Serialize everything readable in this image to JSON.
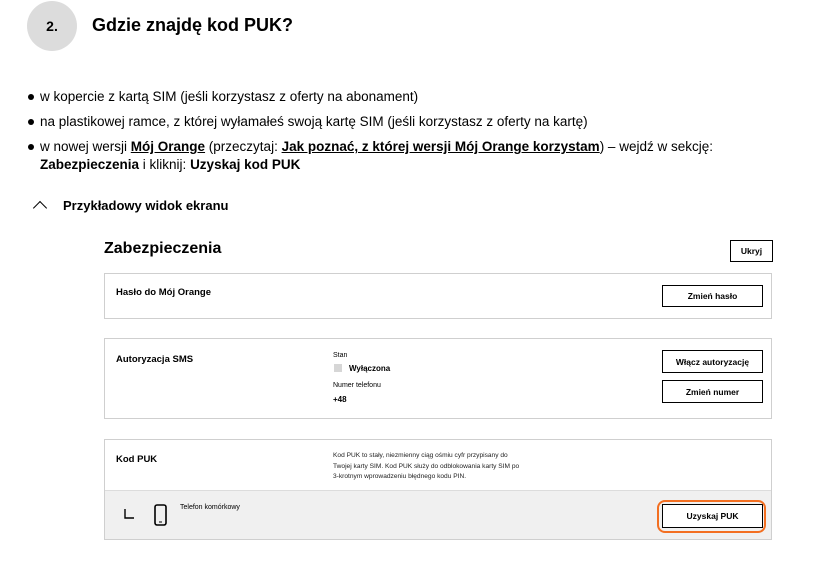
{
  "step": {
    "number": "2.",
    "title": "Gdzie znajdę kod PUK?"
  },
  "bullets": {
    "b1": "w kopercie z kartą SIM (jeśli korzystasz z oferty na abonament)",
    "b2": "na plastikowej ramce, z której wyłamałeś swoją kartę SIM (jeśli korzystasz z oferty na kartę)",
    "b3": {
      "part1": "w nowej wersji ",
      "link1": "Mój Orange",
      "part2": " (przeczytaj: ",
      "link2": "Jak poznać, z której wersji Mój Orange korzystam",
      "part3": ") – wejdź w sekcję: ",
      "bold1": "Zabezpieczenia",
      "part4": " i kliknij: ",
      "bold2": "Uzyskaj kod PUK"
    }
  },
  "example": {
    "label": "Przykładowy widok ekranu",
    "icon": "chevron-up-icon"
  },
  "screen": {
    "title": "Zabezpieczenia",
    "hide_button": "Ukryj",
    "password_card": {
      "label": "Hasło do Mój Orange",
      "button": "Zmień hasło"
    },
    "sms_card": {
      "label": "Autoryzacja SMS",
      "status_label": "Stan",
      "status_value": "Wyłączona",
      "phone_label": "Numer telefonu",
      "phone_value": "+48",
      "enable_button": "Włącz autoryzację",
      "change_number_button": "Zmień numer"
    },
    "puk_card": {
      "label": "Kod PUK",
      "desc_line1": "Kod PUK to stały, niezmienny ciąg ośmiu cyfr przypisany do",
      "desc_line2": "Twojej karty SIM. Kod PUK służy do odblokowania karty SIM po",
      "desc_line3": "3-krotnym wprowadzeniu błędnego kodu PIN.",
      "device_label": "Telefon komórkowy",
      "get_button": "Uzyskaj PUK",
      "highlight_color": "#f36f21"
    }
  }
}
